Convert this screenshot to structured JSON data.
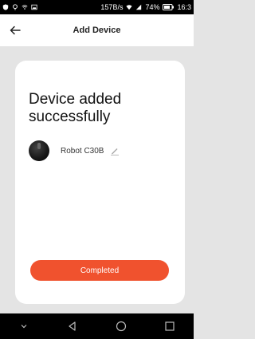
{
  "status_bar": {
    "network_speed": "157B/s",
    "battery": "74%",
    "time": "16:3"
  },
  "header": {
    "title": "Add Device"
  },
  "main": {
    "headline": "Device added successfully",
    "device_name": "Robot C30B",
    "completed_label": "Completed"
  },
  "colors": {
    "accent": "#f0522e",
    "background": "#e4e4e4"
  },
  "icons": {
    "back": "arrow-left-icon",
    "edit": "pencil-icon",
    "nav_down": "chevron-down-icon",
    "nav_back": "triangle-back-icon",
    "nav_home": "circle-home-icon",
    "nav_recent": "square-recent-icon"
  }
}
